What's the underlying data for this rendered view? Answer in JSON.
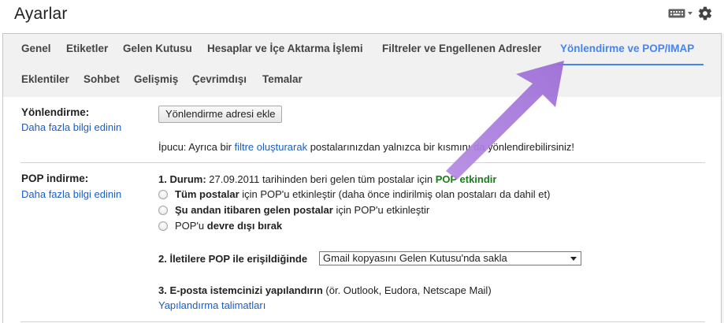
{
  "header": {
    "title": "Ayarlar",
    "icons": [
      "keyboard-icon",
      "gear-icon"
    ]
  },
  "tabs": {
    "row1": [
      {
        "label": "Genel",
        "active": false
      },
      {
        "label": "Etiketler",
        "active": false
      },
      {
        "label": "Gelen Kutusu",
        "active": false
      },
      {
        "label": "Hesaplar ve İçe Aktarma İşlemi",
        "active": false
      },
      {
        "label": "Filtreler ve Engellenen Adresler",
        "active": false
      },
      {
        "label": "Yönlendirme ve POP/IMAP",
        "active": true
      }
    ],
    "row2": [
      {
        "label": "Eklentiler",
        "active": false
      },
      {
        "label": "Sohbet",
        "active": false
      },
      {
        "label": "Gelişmiş",
        "active": false
      },
      {
        "label": "Çevrimdışı",
        "active": false
      },
      {
        "label": "Temalar",
        "active": false
      }
    ]
  },
  "forwarding": {
    "title": "Yönlendirme:",
    "learn_more": "Daha fazla bilgi edinin",
    "add_button": "Yönlendirme adresi ekle",
    "tip_prefix": "İpucu: Ayrıca bir ",
    "tip_link": "filtre oluşturarak",
    "tip_suffix": " postalarınızdan yalnızca bir kısmını da yönlendirebilirsiniz!"
  },
  "pop": {
    "title": "POP indirme:",
    "learn_more": "Daha fazla bilgi edinin",
    "status_label": "1. Durum:",
    "status_text": " 27.09.2011 tarihinden beri gelen tüm postalar için ",
    "status_value": "POP etkindir",
    "options": [
      {
        "bold": "Tüm postalar",
        "rest": " için POP'u etkinleştir (daha önce indirilmiş olan postaları da dahil et)"
      },
      {
        "bold": "Şu andan itibaren gelen postalar",
        "rest": " için POP'u etkinleştir"
      },
      {
        "pre": "POP'u ",
        "bold": "devre dışı bırak"
      }
    ],
    "access_label": "2. İletilere POP ile erişildiğinde",
    "access_select": "Gmail kopyasını Gelen Kutusu'nda sakla",
    "configure_label": "3. E-posta istemcinizi yapılandırın",
    "configure_text": " (ör. Outlook, Eudora, Netscape Mail)",
    "configure_link": "Yapılandırma talimatları"
  },
  "colors": {
    "accent": "#4285f4",
    "link": "#1a5ec4",
    "enabled_green": "#1a7f1a",
    "annotation_arrow": "#9b6bd6"
  }
}
